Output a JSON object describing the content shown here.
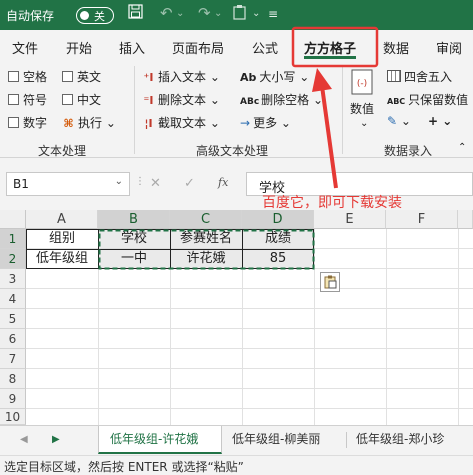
{
  "titlebar": {
    "autosave": "自动保存",
    "toggle": "关"
  },
  "tabs": [
    "文件",
    "开始",
    "插入",
    "页面布局",
    "公式",
    "方方格子",
    "数据",
    "审阅"
  ],
  "ribbon": {
    "col1": [
      "空格",
      "符号",
      "数字"
    ],
    "col2": [
      "英文",
      "中文",
      "执行"
    ],
    "col3": [
      "插入文本",
      "删除文本",
      "截取文本"
    ],
    "col4": [
      "大小写",
      "删除空格",
      "更多"
    ],
    "col4_icons": [
      "Ab",
      "ABc",
      ""
    ],
    "numvalue": "数值",
    "col5": [
      "四舍五入",
      "只保留数值"
    ],
    "col5_icon2": "ABC",
    "groups": [
      "文本处理",
      "高级文本处理",
      "数据录入"
    ]
  },
  "formula_bar": {
    "name_box": "B1",
    "fx": "fx",
    "content": "学校"
  },
  "annotation": "百度它，即可下载安装",
  "columns": [
    "A",
    "B",
    "C",
    "D",
    "E",
    "F"
  ],
  "rows": [
    "1",
    "2",
    "3",
    "4",
    "5",
    "6",
    "7",
    "8",
    "9",
    "10"
  ],
  "table": [
    [
      "组别",
      "学校",
      "参赛姓名",
      "成绩"
    ],
    [
      "低年级组",
      "一中",
      "许花娥",
      "85"
    ]
  ],
  "sheets": [
    "低年级组-许花娥",
    "低年级组-柳美丽",
    "低年级组-郑小珍"
  ],
  "status": "选定目标区域，然后按 ENTER 或选择“粘贴”"
}
